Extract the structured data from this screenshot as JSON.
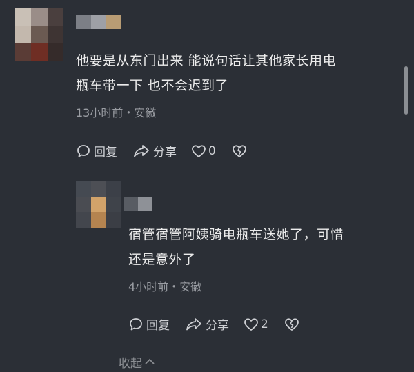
{
  "comment": {
    "lines": [
      "他要是从东门出来 能说句话让其他家长用电",
      "瓶车带一下 也不会迟到了"
    ],
    "meta": "13小时前・安徽",
    "reply_label": "回复",
    "share_label": "分享",
    "like_count": "0"
  },
  "reply": {
    "lines": [
      "宿管宿管阿姨骑电瓶车送她了，可惜",
      "还是意外了"
    ],
    "meta": "4小时前・安徽",
    "reply_label": "回复",
    "share_label": "分享",
    "like_count": "2"
  },
  "collapse_label": "收起",
  "colors": {
    "background": "#2b2f36",
    "text": "#ececec",
    "muted": "#9a9da3"
  }
}
